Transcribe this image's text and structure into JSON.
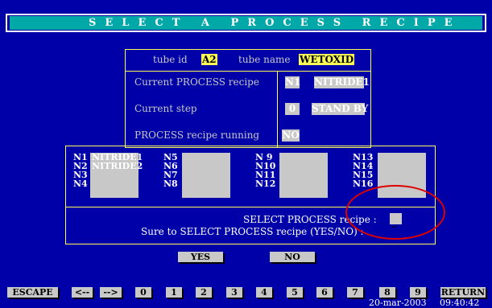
{
  "title": "SELECT A PROCESS RECIPE",
  "tube": {
    "id_label": "tube id",
    "id_value": "A2",
    "name_label": "tube name",
    "name_value": "WETOXID"
  },
  "info": {
    "current_recipe_label": "Current PROCESS recipe",
    "current_recipe_code": "N1",
    "current_recipe_name": "NITRIDE1",
    "current_step_label": "Current step",
    "current_step_value": "0",
    "current_step_name": "STAND BY",
    "running_label": "PROCESS recipe running",
    "running_value": "NO"
  },
  "recipes": {
    "col1": {
      "labels": [
        "N1",
        "N2",
        "N3",
        "N4"
      ],
      "names": [
        "NITRIDE1",
        "NITRIDE2"
      ]
    },
    "col2": {
      "labels": [
        "N5",
        "N6",
        "N7",
        "N8"
      ]
    },
    "col3": {
      "labels": [
        "N 9",
        "N10",
        "N11",
        "N12"
      ]
    },
    "col4": {
      "labels": [
        "N13",
        "N14",
        "N15",
        "N16"
      ]
    }
  },
  "prompts": {
    "select": "SELECT PROCESS recipe :",
    "confirm": "Sure to SELECT PROCESS recipe (YES/NO) :",
    "input_value": "_"
  },
  "confirm_buttons": {
    "yes": "YES",
    "no": "NO"
  },
  "function_keys": {
    "escape": "ESCAPE",
    "left": "<--",
    "right": "-->",
    "digits": [
      "0",
      "1",
      "2",
      "3",
      "4",
      "5",
      "6",
      "7",
      "8",
      "9"
    ],
    "return": "RETURN"
  },
  "status": {
    "date": "20-mar-2003",
    "time": "09:40:42"
  },
  "colors": {
    "background": "#0000a8",
    "title_bar": "#00a8a8",
    "frame": "#ffff55",
    "field": "#c8c8c8",
    "annotation": "#e00000"
  }
}
